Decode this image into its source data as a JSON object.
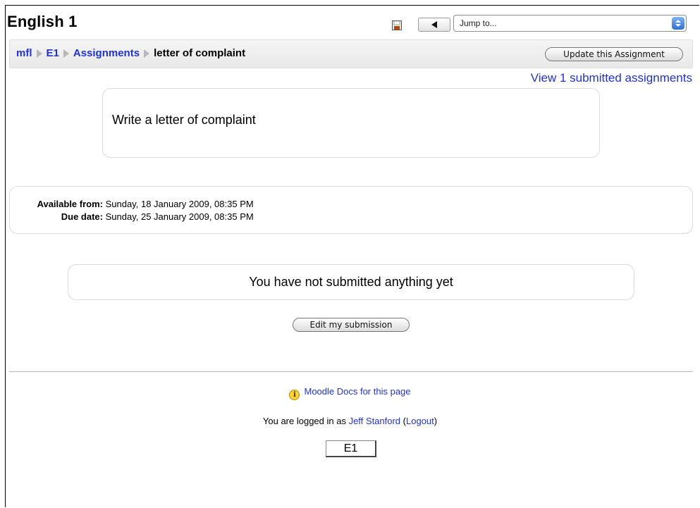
{
  "header": {
    "course_title": "English 1",
    "jump_placeholder": "Jump to..."
  },
  "breadcrumb": {
    "items": [
      "mfl",
      "E1",
      "Assignments"
    ],
    "current": "letter of complaint"
  },
  "actions": {
    "update_label": "Update this Assignment",
    "view_submitted_label": "View 1 submitted assignments"
  },
  "assignment": {
    "intro": "Write a letter of complaint",
    "available_label": "Available from:",
    "available_value": "Sunday, 18 January 2009, 08:35 PM",
    "due_label": "Due date:",
    "due_value": "Sunday, 25 January 2009, 08:35 PM"
  },
  "submission": {
    "status": "You have not submitted anything yet",
    "edit_label": "Edit my submission"
  },
  "footer": {
    "docs_icon_glyph": "i",
    "docs_link": "Moodle Docs for this page",
    "logged_in_prefix": "You are logged in as ",
    "user_name": "Jeff Stanford",
    "logout_open": " (",
    "logout_label": "Logout",
    "logout_close": ")",
    "course_short": "E1"
  },
  "colors": {
    "link": "#2233cc",
    "navbar_bg": "#efefef",
    "box_border": "#dcdcdc"
  },
  "icons": [
    "save-icon",
    "back-arrow-icon",
    "select-arrows-icon",
    "breadcrumb-separator-icon",
    "info-icon"
  ]
}
